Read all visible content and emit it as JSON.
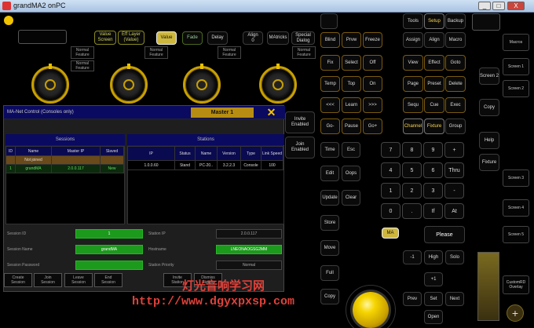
{
  "window": {
    "title": "grandMA2 onPC",
    "min": "_",
    "max": "□",
    "close": "X"
  },
  "top_buttons": [
    {
      "id": "value",
      "label": "Value\nScreen"
    },
    {
      "id": "efflayer",
      "label": "Eff Layer\n(Value)"
    },
    {
      "id": "value2",
      "label": "Value"
    },
    {
      "id": "fade",
      "label": "Fade"
    },
    {
      "id": "delay",
      "label": "Delay"
    },
    {
      "id": "align",
      "label": "Align\n0"
    },
    {
      "id": "matricks",
      "label": "MAtricks"
    },
    {
      "id": "special",
      "label": "Special\nDialog"
    }
  ],
  "encoder_labels": [
    "Normal\nFeature",
    "Normal\nFeature",
    "Normal\nFeature",
    "Normal\nFeature",
    "Normal\nFeature"
  ],
  "dialog": {
    "title": "MA-Net Control (Consoles only)",
    "master": "Master 1",
    "close": "✕",
    "sessions_header": "Sessions",
    "stations_header": "Stations",
    "sessions_cols": [
      "ID",
      "Name",
      "Master IP",
      "Slaved"
    ],
    "sessions_rows": [
      {
        "id": "",
        "name": "Not joined",
        "ip": "",
        "slaved": ""
      },
      {
        "id": "1",
        "name": "grandMA",
        "ip": "2.0.0.117",
        "slaved": "New"
      }
    ],
    "stations_cols": [
      "IP",
      "Status",
      "Name",
      "Version",
      "Type",
      "Link Speed"
    ],
    "stations_rows": [
      {
        "ip": "1.0.0.60",
        "status": "Stand",
        "name": "PC-20..",
        "version": "3.2.2.3",
        "type": "Console",
        "speed": "100"
      }
    ],
    "fields": {
      "session_id_label": "Session ID",
      "session_id": "1",
      "station_ip_label": "Station IP",
      "station_ip": "2.0.0.117",
      "session_name_label": "Session Name",
      "session_name": "grandMA",
      "hostname_label": "Hostname",
      "hostname": "LNEONAOGSG2MM",
      "session_password_label": "Session Password",
      "session_password": "",
      "station_priority_label": "Station Priority",
      "station_priority": "Normal"
    },
    "side_buttons": [
      "Invite\nEnabled",
      "Join\nEnabled"
    ],
    "bottom_buttons": [
      "Create\nSession",
      "Join\nSession",
      "Leave\nSession",
      "End\nSession",
      "Invite\nStation",
      "Dismiss\nStation"
    ]
  },
  "key_grid": [
    [
      "",
      "Tools",
      "Setup",
      "Backup"
    ],
    [
      "Blind",
      "Prvw",
      "Freeze",
      "Assign",
      "Align",
      "Macro"
    ],
    [
      "Fix",
      "Select",
      "Off",
      "View",
      "Effect",
      "Goto"
    ],
    [
      "Temp",
      "Top",
      "On",
      "Page",
      "Preset",
      "Delete"
    ],
    [
      "<<<",
      "Learn",
      ">>>",
      "Sequ",
      "Cue",
      "Exec"
    ],
    [
      "Go-",
      "Pause",
      "Go+",
      "Channel",
      "Fixture",
      "Group"
    ]
  ],
  "numpad": {
    "rows": [
      [
        "7",
        "8",
        "9",
        "+"
      ],
      [
        "4",
        "5",
        "6",
        "Thru"
      ],
      [
        "1",
        "2",
        "3",
        "-"
      ],
      [
        "0",
        ".",
        "If",
        "At"
      ]
    ],
    "ma": "MA",
    "please": "Please",
    "left_col": [
      "Time",
      "Edit",
      "Update",
      "Store",
      "Move",
      "Full",
      "Copy",
      "Clear",
      "Oops",
      "Esc"
    ],
    "nav": [
      "-1",
      "High",
      "Solo",
      "+1",
      "Prev",
      "Set",
      "Next",
      "Open"
    ]
  },
  "right_edge": [
    "Macros",
    "Screen 1",
    "Screen 2",
    "Delete",
    "Copy",
    "Help",
    "Fixture",
    "Screen 3",
    "Screen 4",
    "Screen 5",
    "Screen 6",
    "CustomRD\nOverlay"
  ],
  "watermark": {
    "cn": "灯光音响学习网",
    "url": "http://www.dgyxpxsp.com"
  },
  "colors": {
    "accent": "#cdb73c",
    "dialog_blue": "#0a0a60",
    "green_field": "#1c9a1c",
    "master_gold": "#b68d12"
  }
}
